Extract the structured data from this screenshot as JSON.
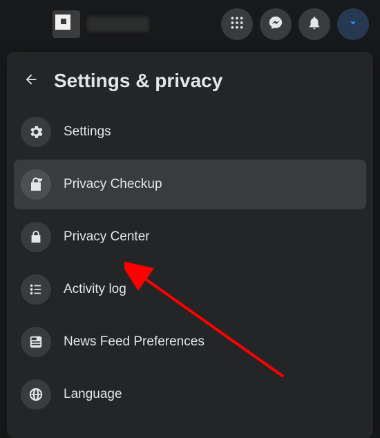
{
  "topbar": {
    "username_obscured": true,
    "buttons": {
      "menu_grid": "menu",
      "messenger": "messenger",
      "notifications": "notifications",
      "account_dropdown": "account"
    }
  },
  "panel": {
    "title": "Settings & privacy",
    "items": [
      {
        "id": "settings",
        "label": "Settings",
        "icon": "gear-icon",
        "highlight": false
      },
      {
        "id": "privacy-checkup",
        "label": "Privacy Checkup",
        "icon": "lock-heart-icon",
        "highlight": true
      },
      {
        "id": "privacy-center",
        "label": "Privacy Center",
        "icon": "lock-icon",
        "highlight": false
      },
      {
        "id": "activity-log",
        "label": "Activity log",
        "icon": "list-icon",
        "highlight": false
      },
      {
        "id": "news-feed-preferences",
        "label": "News Feed Preferences",
        "icon": "feed-icon",
        "highlight": false
      },
      {
        "id": "language",
        "label": "Language",
        "icon": "globe-icon",
        "highlight": false
      }
    ]
  },
  "annotation": {
    "arrow_color": "#ff0000",
    "points_to": "privacy-checkup"
  }
}
